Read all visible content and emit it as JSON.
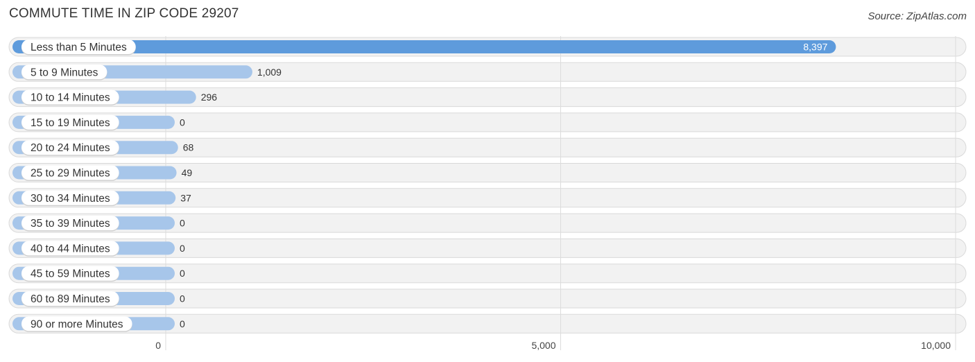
{
  "header": {
    "title": "COMMUTE TIME IN ZIP CODE 29207",
    "source": "Source: ZipAtlas.com"
  },
  "colors": {
    "bar": "#a7c6ea",
    "bar_highlight": "#5e9bdc",
    "row_background": "#f2f2f2"
  },
  "chart_data": {
    "type": "bar",
    "orientation": "horizontal",
    "title": "COMMUTE TIME IN ZIP CODE 29207",
    "xlabel": "",
    "ylabel": "",
    "xlim": [
      0,
      10000
    ],
    "grid": true,
    "categories": [
      "Less than 5 Minutes",
      "5 to 9 Minutes",
      "10 to 14 Minutes",
      "15 to 19 Minutes",
      "20 to 24 Minutes",
      "25 to 29 Minutes",
      "30 to 34 Minutes",
      "35 to 39 Minutes",
      "40 to 44 Minutes",
      "45 to 59 Minutes",
      "60 to 89 Minutes",
      "90 or more Minutes"
    ],
    "values": [
      8397,
      1009,
      296,
      0,
      68,
      49,
      37,
      0,
      0,
      0,
      0,
      0
    ],
    "value_labels": [
      "8,397",
      "1,009",
      "296",
      "0",
      "68",
      "49",
      "37",
      "0",
      "0",
      "0",
      "0",
      "0"
    ],
    "highlight_index": 0,
    "x_ticks": [
      0,
      5000,
      10000
    ],
    "x_tick_labels": [
      "0",
      "5,000",
      "10,000"
    ]
  }
}
